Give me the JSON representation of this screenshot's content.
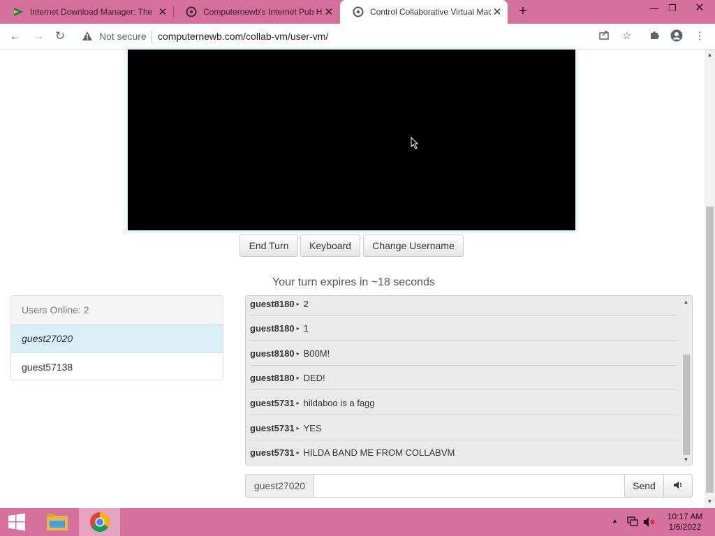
{
  "browser": {
    "tabs": [
      {
        "title": "Internet Download Manager: The",
        "icon": "idm-play-icon",
        "active": false
      },
      {
        "title": "Computernewb's Internet Pub Hu",
        "icon": "site-favicon",
        "active": false
      },
      {
        "title": "Control Collaborative Virtual Mac",
        "icon": "site-favicon",
        "active": true
      }
    ],
    "security_label": "Not secure",
    "url": "computernewb.com/collab-vm/user-vm/"
  },
  "vm": {
    "buttons": {
      "end_turn": "End Turn",
      "keyboard": "Keyboard",
      "change_username": "Change Username"
    },
    "turn_status": "Your turn expires in ~18 seconds"
  },
  "users": {
    "header": "Users Online: 2",
    "list": [
      "guest27020",
      "guest57138"
    ]
  },
  "chat": {
    "messages": [
      {
        "user": "guest8180",
        "text": "2"
      },
      {
        "user": "guest8180",
        "text": "1"
      },
      {
        "user": "guest8180",
        "text": "B00M!"
      },
      {
        "user": "guest8180",
        "text": "DED!"
      },
      {
        "user": "guest5731",
        "text": "hildaboo is a fagg"
      },
      {
        "user": "guest5731",
        "text": "YES"
      },
      {
        "user": "guest5731",
        "text": "HILDA BAND ME FROM COLLABVM"
      }
    ],
    "input_username": "guest27020",
    "input_value": "",
    "send_label": "Send"
  },
  "taskbar": {
    "time": "10:17 AM",
    "date": "1/6/2022"
  },
  "colors": {
    "chrome_frame": "#d5709d",
    "selected_user": "#d9edf7",
    "vm_glow": "#c8ecfb"
  }
}
